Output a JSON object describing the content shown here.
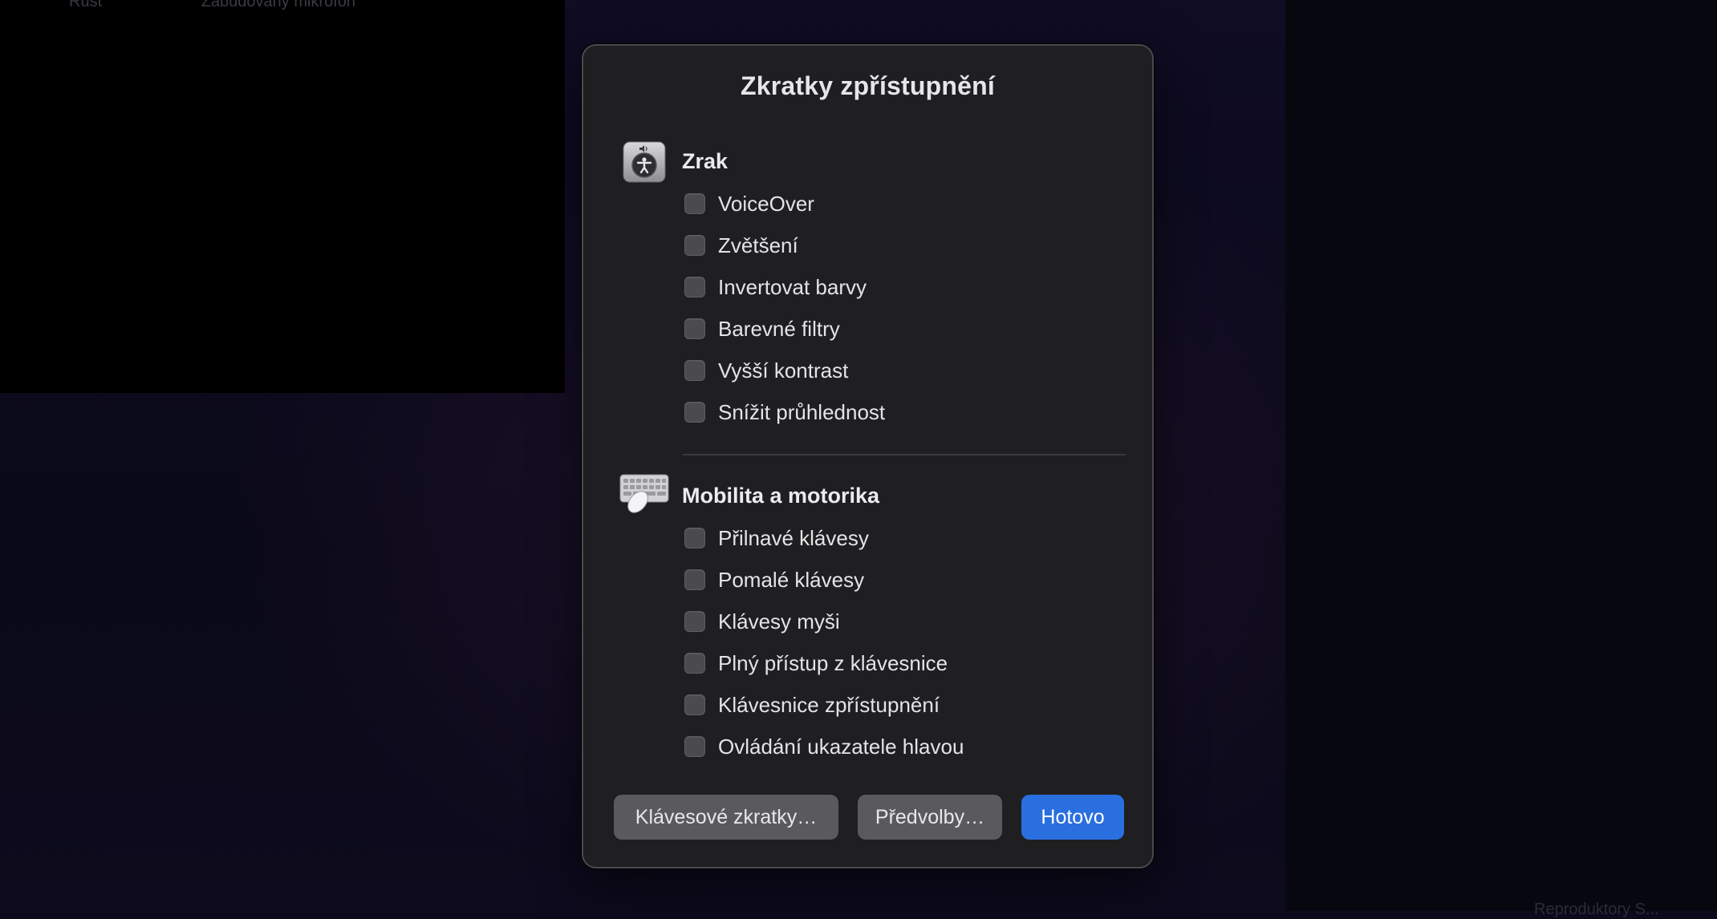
{
  "background": {
    "top_text_left": "Růst",
    "top_text_right": "Zabudovaný mikrofon",
    "bottom_text": "Reproduktory S..."
  },
  "dialog": {
    "title": "Zkratky zpřístupnění",
    "sections": [
      {
        "heading": "Zrak",
        "icon": "accessibility-icon",
        "options": [
          {
            "label": "VoiceOver",
            "checked": false
          },
          {
            "label": "Zvětšení",
            "checked": false
          },
          {
            "label": "Invertovat barvy",
            "checked": false
          },
          {
            "label": "Barevné filtry",
            "checked": false
          },
          {
            "label": "Vyšší kontrast",
            "checked": false
          },
          {
            "label": "Snížit průhlednost",
            "checked": false
          }
        ]
      },
      {
        "heading": "Mobilita a motorika",
        "icon": "keyboard-mouse-icon",
        "options": [
          {
            "label": "Přilnavé klávesy",
            "checked": false
          },
          {
            "label": "Pomalé klávesy",
            "checked": false
          },
          {
            "label": "Klávesy myši",
            "checked": false
          },
          {
            "label": "Plný přístup z klávesnice",
            "checked": false
          },
          {
            "label": "Klávesnice zpřístupnění",
            "checked": false
          },
          {
            "label": "Ovládání ukazatele hlavou",
            "checked": false
          }
        ]
      }
    ],
    "buttons": {
      "shortcuts": "Klávesové zkratky…",
      "preferences": "Předvolby…",
      "done": "Hotovo"
    }
  },
  "colors": {
    "accent": "#2a6fe0",
    "dialog_background": "#1f1f21",
    "checkbox": "#4b4b4f"
  }
}
